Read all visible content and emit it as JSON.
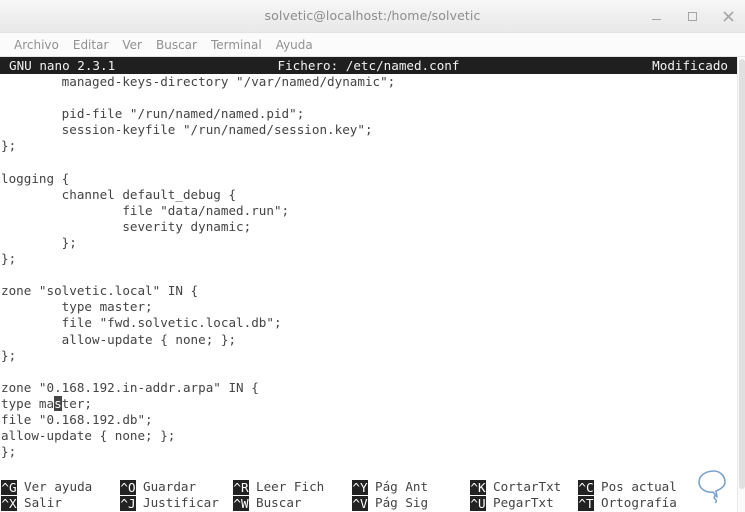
{
  "window": {
    "title": "solvetic@localhost:/home/solvetic",
    "controls": [
      {
        "name": "minimize",
        "glyph": "–"
      },
      {
        "name": "maximize",
        "glyph": "□"
      },
      {
        "name": "close",
        "glyph": "✕"
      }
    ]
  },
  "menubar": {
    "items": [
      {
        "label": "Archivo"
      },
      {
        "label": "Editar"
      },
      {
        "label": "Ver"
      },
      {
        "label": "Buscar"
      },
      {
        "label": "Terminal"
      },
      {
        "label": "Ayuda"
      }
    ]
  },
  "nano": {
    "version": "GNU nano 2.3.1",
    "file_label": "Fichero: /etc/named.conf",
    "modified": "Modificado",
    "filename": "/etc/named.conf",
    "lines": [
      "        managed-keys-directory \"/var/named/dynamic\";",
      "",
      "        pid-file \"/run/named/named.pid\";",
      "        session-keyfile \"/run/named/session.key\";",
      "};",
      "",
      "logging {",
      "        channel default_debug {",
      "                file \"data/named.run\";",
      "                severity dynamic;",
      "        };",
      "};",
      "",
      "zone \"solvetic.local\" IN {",
      "        type master;",
      "        file \"fwd.solvetic.local.db\";",
      "        allow-update { none; };",
      "};",
      "",
      "zone \"0.168.192.in-addr.arpa\" IN {",
      "type master;",
      "file \"0.168.192.db\";",
      "allow-update { none; };",
      "};"
    ],
    "cursor": {
      "line_index": 20,
      "column": 7,
      "char": "."
    },
    "shortcuts": [
      {
        "key": "^G",
        "label": "Ver ayuda",
        "key2": "^X",
        "label2": "Salir"
      },
      {
        "key": "^O",
        "label": "Guardar",
        "key2": "^J",
        "label2": "Justificar"
      },
      {
        "key": "^R",
        "label": "Leer Fich",
        "key2": "^W",
        "label2": "Buscar"
      },
      {
        "key": "^Y",
        "label": "Pág Ant",
        "key2": "^V",
        "label2": "Pág Sig"
      },
      {
        "key": "^K",
        "label": "CortarTxt",
        "key2": "^U",
        "label2": "PegarTxt"
      },
      {
        "key": "^C",
        "label": "Pos actual",
        "key2": "^T",
        "label2": "Ortografía"
      }
    ]
  },
  "colors": {
    "status_bar_bg": "#1f1f1f",
    "status_bar_fg": "#f2f2f2",
    "text_fg": "#444444",
    "titlebar_bg": "#eeeeee",
    "watermark_accent": "#6f9fd0"
  },
  "watermark": {
    "icon": "speech-bubble-logo"
  }
}
